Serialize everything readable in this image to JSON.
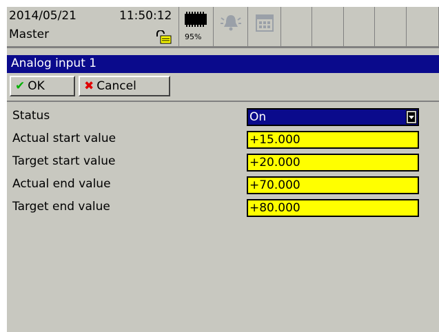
{
  "header": {
    "date": "2014/05/21",
    "time": "11:50:12",
    "user": "Master",
    "memory_percent": "95%",
    "icons": [
      "lock-icon",
      "memory-icon",
      "alarm-bell-icon",
      "calendar-icon"
    ]
  },
  "dialog": {
    "title": "Analog input 1",
    "ok_label": "OK",
    "cancel_label": "Cancel"
  },
  "fields": [
    {
      "label": "Status",
      "value": "On",
      "type": "select"
    },
    {
      "label": "Actual start value",
      "value": "+15.000",
      "type": "input"
    },
    {
      "label": "Target start value",
      "value": "+20.000",
      "type": "input"
    },
    {
      "label": "Actual end value",
      "value": "+70.000",
      "type": "input"
    },
    {
      "label": "Target end value",
      "value": "+80.000",
      "type": "input"
    }
  ],
  "colors": {
    "panel": "#c8c8c0",
    "title_bar": "#0a0a8c",
    "field_bg": "#ffff00",
    "ok_icon": "#00b000",
    "cancel_icon": "#e00000"
  }
}
